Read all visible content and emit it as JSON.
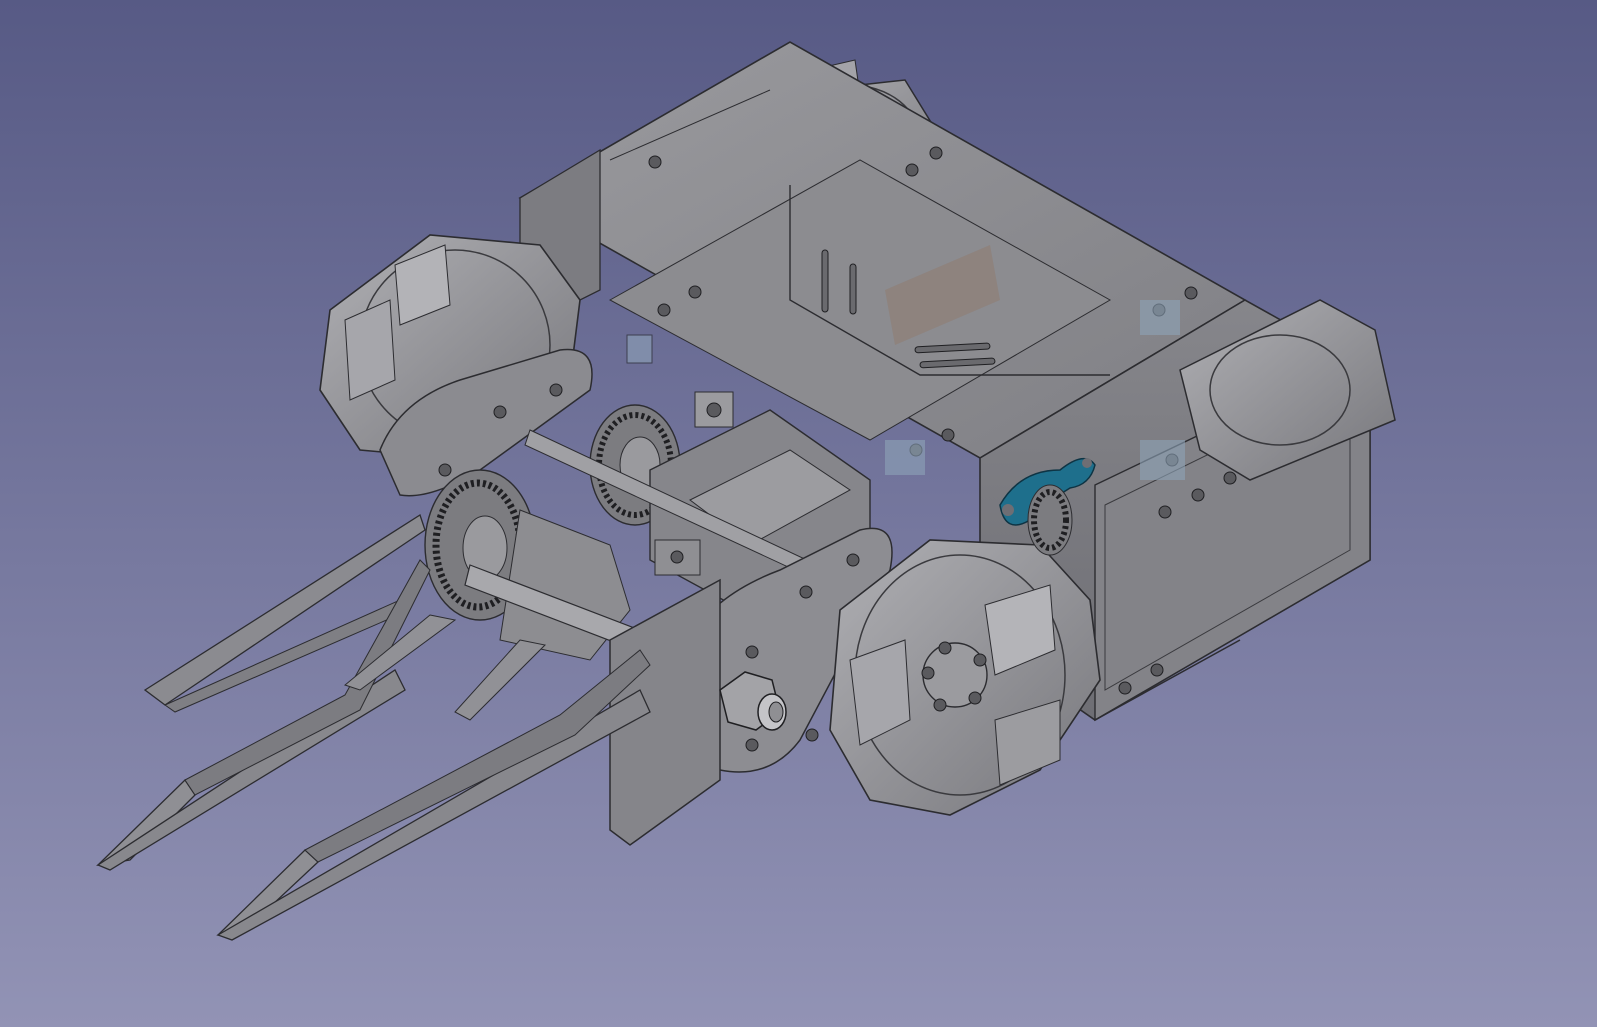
{
  "viewport": {
    "background_top": "#575a85",
    "background_bottom": "#9293b5",
    "projection": "isometric"
  },
  "model": {
    "kind": "robot-chassis-3d-model",
    "body_color": "#8a8a8e",
    "edge_color": "#2c2c30",
    "selected_part_color": "#1e6f8c",
    "parts": [
      "chassis-box",
      "top-plate",
      "front-plate",
      "wheel-rear-left",
      "wheel-rear-right",
      "wheel-front-right",
      "wheel-front-left",
      "motor-bracket-left",
      "motor-bracket-right",
      "pulley-gear-upper",
      "pulley-gear-lower",
      "drive-shaft",
      "axle-nut",
      "fork-prongs",
      "pillow-block",
      "blue-clip"
    ]
  }
}
